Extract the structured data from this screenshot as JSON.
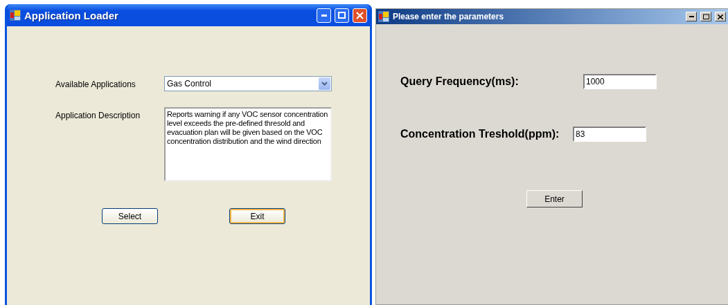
{
  "windows": [
    {
      "kind": "xp",
      "title": "Application Loader",
      "fields": [
        {
          "label": "Available Applications",
          "kind": "combo",
          "value": "Gas Control"
        },
        {
          "label": "Application Description",
          "kind": "memo",
          "value": "Reports warning if any VOC sensor concentration level exceeds the pre-defined thresold and evacuation plan will be given based on the VOC concentration distribution and the wind direction"
        }
      ],
      "buttons": [
        {
          "label": "Select",
          "focused": false
        },
        {
          "label": "Exit",
          "focused": true
        }
      ]
    },
    {
      "kind": "classic",
      "title": "Please enter the parameters",
      "fields": [
        {
          "label": "Query Frequency(ms):",
          "kind": "text",
          "value": "1000"
        },
        {
          "label": "Concentration Treshold(ppm):",
          "kind": "text",
          "value": "83"
        }
      ],
      "buttons": [
        {
          "label": "Enter",
          "focused": false
        }
      ]
    }
  ]
}
